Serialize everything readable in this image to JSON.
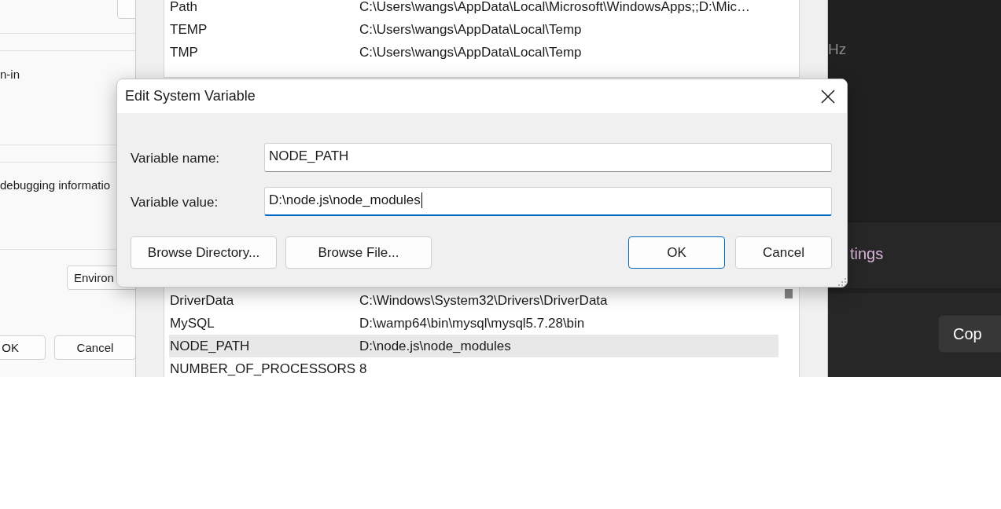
{
  "system_properties": {
    "texts": [
      "n-in",
      "debugging informatio"
    ],
    "environment_button": "Environ",
    "buttons": [
      "OK",
      "Cancel"
    ]
  },
  "environment_variables": {
    "user_variables": [
      {
        "name": "Path",
        "value": "C:\\Users\\wangs\\AppData\\Local\\Microsoft\\WindowsApps;;D:\\Mic…",
        "selected": false
      },
      {
        "name": "TEMP",
        "value": "C:\\Users\\wangs\\AppData\\Local\\Temp",
        "selected": false
      },
      {
        "name": "TMP",
        "value": "C:\\Users\\wangs\\AppData\\Local\\Temp",
        "selected": false
      }
    ],
    "system_variables": [
      {
        "name": "DriverData",
        "value": "C:\\Windows\\System32\\Drivers\\DriverData",
        "selected": false
      },
      {
        "name": "MySQL",
        "value": "D:\\wamp64\\bin\\mysql\\mysql5.7.28\\bin",
        "selected": false
      },
      {
        "name": "NODE_PATH",
        "value": "D:\\node.js\\node_modules",
        "selected": true
      },
      {
        "name": "NUMBER_OF_PROCESSORS",
        "value": "8",
        "selected": false
      }
    ]
  },
  "settings_window": {
    "frequency_text": "Hz",
    "link": "tings",
    "copy_button": "Cop"
  },
  "dialog": {
    "title": "Edit System Variable",
    "fields": [
      {
        "label": "Variable name:",
        "value": "NODE_PATH",
        "focused": false
      },
      {
        "label": "Variable value:",
        "value": "D:\\node.js\\node_modules",
        "focused": true
      }
    ],
    "buttons": [
      {
        "label": "Browse Directory...",
        "default": false
      },
      {
        "label": "Browse File...",
        "default": false
      },
      {
        "label": "OK",
        "default": true
      },
      {
        "label": "Cancel",
        "default": false
      }
    ]
  }
}
